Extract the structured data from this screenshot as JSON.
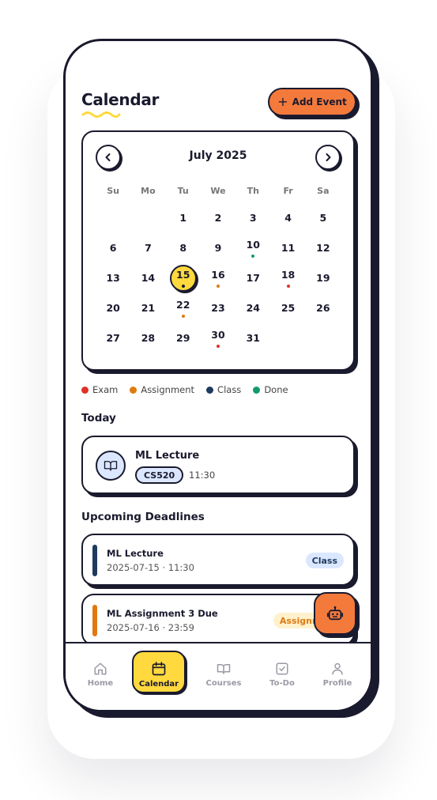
{
  "header": {
    "title": "Calendar",
    "add_event_label": "Add Event"
  },
  "calendar": {
    "month_label": "July 2025",
    "weekdays": [
      "Su",
      "Mo",
      "Tu",
      "We",
      "Th",
      "Fr",
      "Sa"
    ],
    "leading_blanks": 2,
    "selected_day": 15,
    "days": [
      {
        "n": "1"
      },
      {
        "n": "2"
      },
      {
        "n": "3"
      },
      {
        "n": "4"
      },
      {
        "n": "5"
      },
      {
        "n": "6"
      },
      {
        "n": "7"
      },
      {
        "n": "8"
      },
      {
        "n": "9"
      },
      {
        "n": "10",
        "dot": "#139a6c"
      },
      {
        "n": "11"
      },
      {
        "n": "12"
      },
      {
        "n": "13"
      },
      {
        "n": "14"
      },
      {
        "n": "15",
        "dot": "#1a1a2e"
      },
      {
        "n": "16",
        "dot": "#e07a10"
      },
      {
        "n": "17"
      },
      {
        "n": "18",
        "dot": "#e0302a"
      },
      {
        "n": "19"
      },
      {
        "n": "20"
      },
      {
        "n": "21"
      },
      {
        "n": "22",
        "dot": "#e07a10"
      },
      {
        "n": "23"
      },
      {
        "n": "24"
      },
      {
        "n": "25"
      },
      {
        "n": "26"
      },
      {
        "n": "27"
      },
      {
        "n": "28"
      },
      {
        "n": "29"
      },
      {
        "n": "30",
        "dot": "#e0302a"
      },
      {
        "n": "31"
      }
    ]
  },
  "legend": [
    {
      "label": "Exam",
      "color": "#e0302a"
    },
    {
      "label": "Assignment",
      "color": "#e07a10"
    },
    {
      "label": "Class",
      "color": "#1e3a5f"
    },
    {
      "label": "Done",
      "color": "#139a6c"
    }
  ],
  "today": {
    "section_title": "Today",
    "event": {
      "title": "ML Lecture",
      "course": "CS520",
      "time": "11:30",
      "icon": "book-icon"
    }
  },
  "deadlines": {
    "section_title": "Upcoming Deadlines",
    "items": [
      {
        "title": "ML Lecture",
        "sub": "2025-07-15 · 11:30",
        "badge": "Class",
        "bar_color": "#1e3a5f",
        "badge_bg": "#dbe7ff",
        "badge_color": "#1e3a5f"
      },
      {
        "title": "ML Assignment 3 Due",
        "sub": "2025-07-16 · 23:59",
        "badge": "Assignment",
        "bar_color": "#e07a10",
        "badge_bg": "#fff1cc",
        "badge_color": "#e07a10"
      }
    ]
  },
  "fab": {
    "icon": "robot-icon"
  },
  "bottom_nav": [
    {
      "label": "Home",
      "icon": "home-icon",
      "active": false
    },
    {
      "label": "Calendar",
      "icon": "calendar-icon",
      "active": true
    },
    {
      "label": "Courses",
      "icon": "open-book-icon",
      "active": false
    },
    {
      "label": "To-Do",
      "icon": "checkbox-icon",
      "active": false
    },
    {
      "label": "Profile",
      "icon": "user-icon",
      "active": false
    }
  ]
}
